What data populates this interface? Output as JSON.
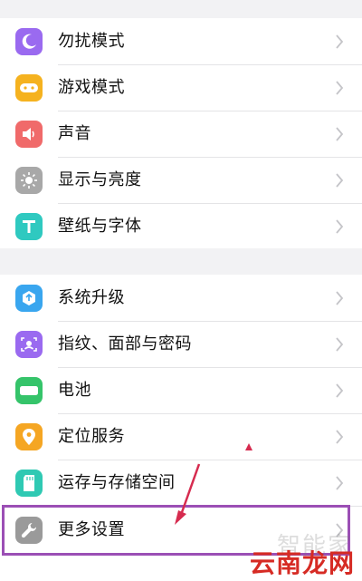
{
  "colors": {
    "moon": "#9a6af0",
    "game": "#f5b21f",
    "sound": "#f06a6a",
    "display": "#a8a8a8",
    "font": "#2fc9c0",
    "update": "#39a6ef",
    "fingerprint": "#9a6af0",
    "battery": "#35c46a",
    "location": "#f5a623",
    "storage": "#2fc9b3",
    "more": "#9a9a9a",
    "annotation": "#d62b4f",
    "highlight": "#9b4fb5"
  },
  "settings": {
    "group1": [
      {
        "label": "勿扰模式",
        "icon": "moon-icon"
      },
      {
        "label": "游戏模式",
        "icon": "gamepad-icon"
      },
      {
        "label": "声音",
        "icon": "speaker-icon"
      },
      {
        "label": "显示与亮度",
        "icon": "sun-icon"
      },
      {
        "label": "壁纸与字体",
        "icon": "font-t-icon"
      }
    ],
    "group2": [
      {
        "label": "系统升级",
        "icon": "system-update-icon"
      },
      {
        "label": "指纹、面部与密码",
        "icon": "face-id-icon"
      },
      {
        "label": "电池",
        "icon": "battery-icon"
      },
      {
        "label": "定位服务",
        "icon": "location-pin-icon"
      },
      {
        "label": "运存与存储空间",
        "icon": "sd-card-icon"
      },
      {
        "label": "更多设置",
        "icon": "wrench-icon"
      }
    ]
  },
  "watermark": {
    "top": "智能家",
    "bottom": "云南龙网"
  }
}
